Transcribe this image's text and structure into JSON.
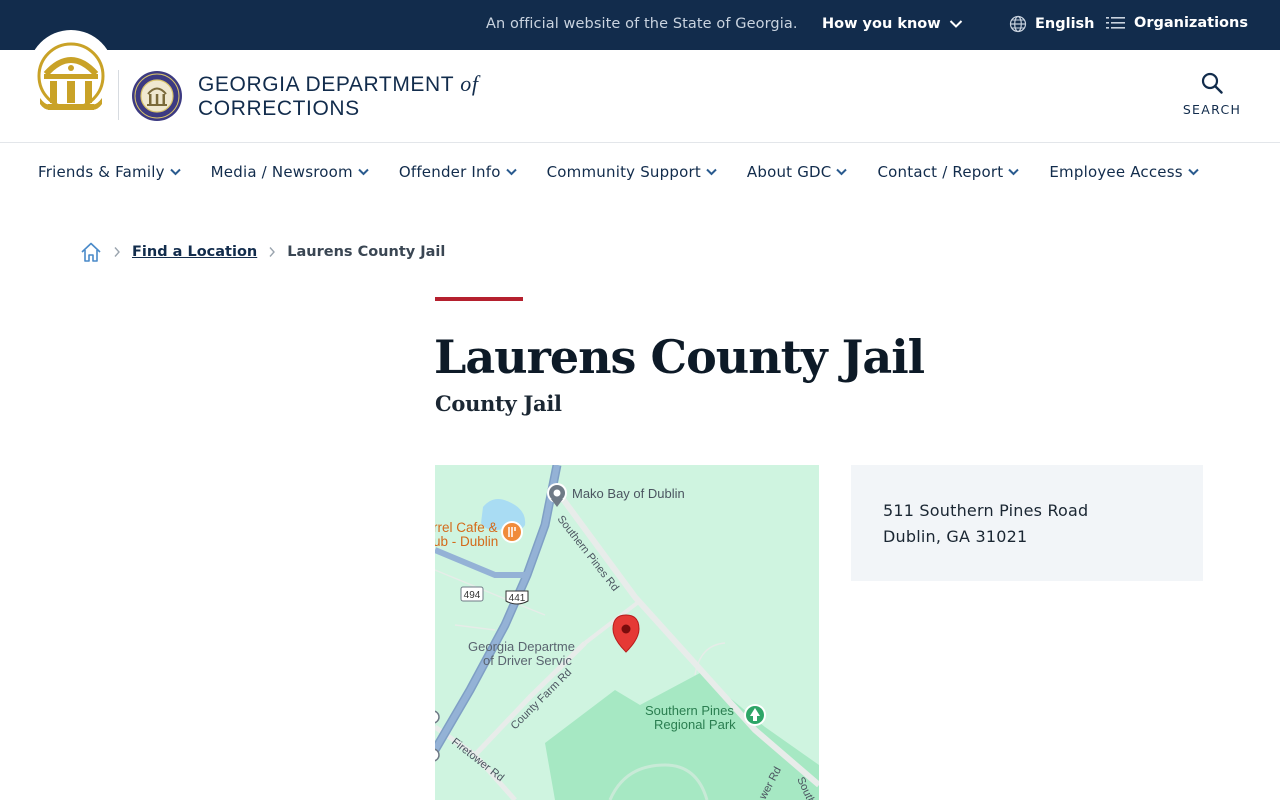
{
  "topbar": {
    "official_text": "An official website of the State of Georgia.",
    "how_you_know": "How you know",
    "language": "English",
    "organizations": "Organizations"
  },
  "header": {
    "agency_line1": "GEORGIA DEPARTMENT",
    "agency_of": "of",
    "agency_line2": "CORRECTIONS",
    "search_label": "SEARCH"
  },
  "nav": {
    "items": [
      {
        "label": "Friends & Family"
      },
      {
        "label": "Media / Newsroom"
      },
      {
        "label": "Offender Info"
      },
      {
        "label": "Community Support"
      },
      {
        "label": "About GDC"
      },
      {
        "label": "Contact / Report"
      },
      {
        "label": "Employee Access"
      }
    ]
  },
  "breadcrumb": {
    "link": "Find a Location",
    "current": "Laurens County Jail"
  },
  "page": {
    "title": "Laurens County Jail",
    "subtitle": "County Jail"
  },
  "map": {
    "labels": {
      "mako": "Mako Bay of Dublin",
      "cafe1": "rrel Cafe &",
      "cafe2": "ub - Dublin",
      "southern_pines_rd": "Southern Pines Rd",
      "route_494": "494",
      "route_441": "441",
      "gdds1": "Georgia Departme",
      "gdds2": "of Driver Servic",
      "county_farm_rd": "County Farm Rd",
      "park1": "Southern Pines",
      "park2": "Regional Park",
      "firetower_rd": "Firetower Rd",
      "tower_rd": "wer Rd",
      "south": "South"
    }
  },
  "address": {
    "line1": "511 Southern Pines Road",
    "line2": "Dublin, GA 31021"
  },
  "colors": {
    "navy": "#122c4c",
    "accent_red": "#b5202e",
    "gold": "#c9a227",
    "map_green": "#cdf5e2",
    "card_bg": "#f2f5f8"
  }
}
